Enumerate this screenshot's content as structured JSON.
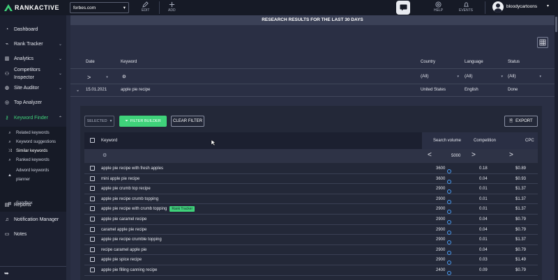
{
  "brand": {
    "name": "RANKACTIVE",
    "accent": "#3fd27a"
  },
  "topbar": {
    "domain": "forbes.com",
    "edit_label": "EDIT",
    "add_label": "ADD",
    "help_label": "HELP",
    "events_label": "EVENTS",
    "username": "bloodycartoons"
  },
  "sidebar": {
    "items": [
      {
        "label": "Dashboard",
        "icon": "dashboard-icon"
      },
      {
        "label": "Rank Tracker",
        "icon": "chart-icon"
      },
      {
        "label": "Analytics",
        "icon": "bars-icon"
      },
      {
        "label": "Competitors Inspector",
        "icon": "people-icon"
      },
      {
        "label": "Site Auditor",
        "icon": "globe-icon"
      },
      {
        "label": "Top Analyzer",
        "icon": "target-icon"
      },
      {
        "label": "Keyword Finder",
        "icon": "key-icon"
      },
      {
        "label": "Reports",
        "icon": "report-icon"
      },
      {
        "label": "Notification Manager",
        "icon": "bell-icon"
      },
      {
        "label": "Notes",
        "icon": "notes-icon"
      }
    ],
    "sub_items": [
      "Related keywords",
      "Keyword suggestions",
      "Similar keywords",
      "Ranked keywords",
      "Adword keywords planner",
      "Sandbox"
    ]
  },
  "main": {
    "banner": "RESEARCH RESULTS FOR THE LAST 30 DAYS",
    "headers": {
      "date": "Date",
      "keyword": "Keyword",
      "country": "Country",
      "language": "Language",
      "status": "Status"
    },
    "filters": {
      "country": "(All)",
      "language": "(All)",
      "status": "(All)"
    },
    "research": {
      "date": "15.01.2021",
      "keyword": "apple pie recipe",
      "country": "United States",
      "language": "English",
      "status": "Done"
    }
  },
  "panel": {
    "selected_label": "SELECTED",
    "filter_builder_label": "FILTER BUILDER",
    "clear_filter_label": "CLEAR FILTER",
    "export_label": "EXPORT",
    "columns": {
      "keyword": "Keyword",
      "search_volume": "Search volume",
      "competition": "Competition",
      "cpc": "CPC"
    },
    "volume_filter": "5000",
    "rows": [
      {
        "keyword": "apple pie recipe with fresh apples",
        "volume": "3600",
        "competition": "0.18",
        "cpc": "$0.89",
        "badge": ""
      },
      {
        "keyword": "mini apple pie recipe",
        "volume": "3600",
        "competition": "0.04",
        "cpc": "$0.93",
        "badge": ""
      },
      {
        "keyword": "apple pie crumb top recipe",
        "volume": "2900",
        "competition": "0.01",
        "cpc": "$1.37",
        "badge": ""
      },
      {
        "keyword": "apple pie recipe crumb topping",
        "volume": "2900",
        "competition": "0.01",
        "cpc": "$1.37",
        "badge": ""
      },
      {
        "keyword": "apple pie recipe with crumb topping",
        "volume": "2900",
        "competition": "0.01",
        "cpc": "$1.37",
        "badge": "Rank Tracker"
      },
      {
        "keyword": "apple pie caramel recipe",
        "volume": "2900",
        "competition": "0.04",
        "cpc": "$0.79",
        "badge": ""
      },
      {
        "keyword": "caramel apple pie recipe",
        "volume": "2900",
        "competition": "0.04",
        "cpc": "$0.79",
        "badge": ""
      },
      {
        "keyword": "apple pie recipe crumble topping",
        "volume": "2900",
        "competition": "0.01",
        "cpc": "$1.37",
        "badge": ""
      },
      {
        "keyword": "recipe caramel apple pie",
        "volume": "2900",
        "competition": "0.04",
        "cpc": "$0.79",
        "badge": ""
      },
      {
        "keyword": "apple pie spice recipe",
        "volume": "2900",
        "competition": "0.03",
        "cpc": "$1.49",
        "badge": ""
      },
      {
        "keyword": "apple pie filling canning recipe",
        "volume": "2400",
        "competition": "0.09",
        "cpc": "$0.79",
        "badge": ""
      }
    ]
  }
}
